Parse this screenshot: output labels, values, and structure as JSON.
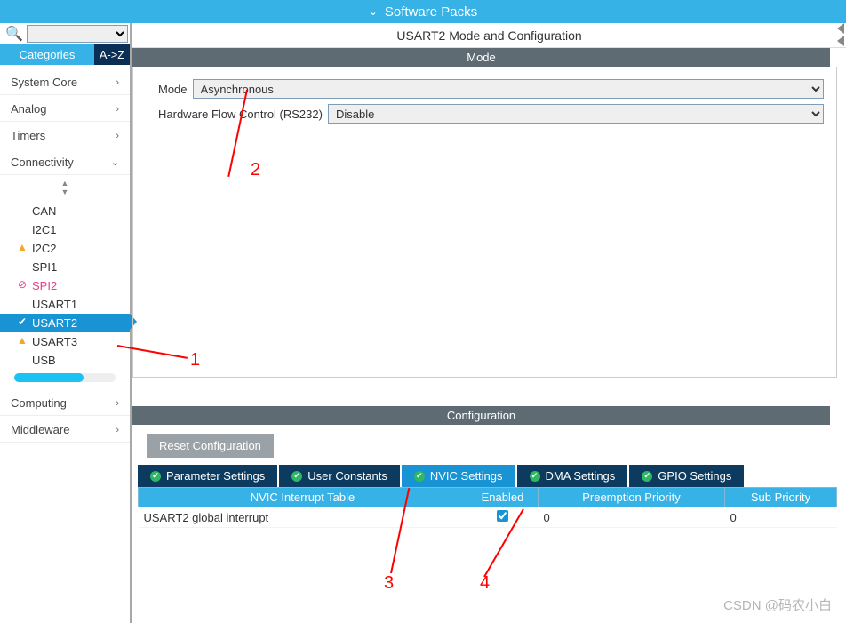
{
  "topbar": {
    "title": "Software Packs"
  },
  "sidebar": {
    "tabs": {
      "categories": "Categories",
      "az": "A->Z"
    },
    "groups": [
      {
        "label": "System Core",
        "chev": "›"
      },
      {
        "label": "Analog",
        "chev": "›"
      },
      {
        "label": "Timers",
        "chev": "›"
      },
      {
        "label": "Connectivity",
        "chev": "⌄",
        "expanded": true,
        "items": [
          {
            "label": "CAN",
            "state": "plain"
          },
          {
            "label": "I2C1",
            "state": "plain"
          },
          {
            "label": "I2C2",
            "state": "warn"
          },
          {
            "label": "SPI1",
            "state": "plain"
          },
          {
            "label": "SPI2",
            "state": "no"
          },
          {
            "label": "USART1",
            "state": "plain"
          },
          {
            "label": "USART2",
            "state": "sel"
          },
          {
            "label": "USART3",
            "state": "warn"
          },
          {
            "label": "USB",
            "state": "plain"
          }
        ]
      },
      {
        "label": "Computing",
        "chev": "›"
      },
      {
        "label": "Middleware",
        "chev": "›"
      }
    ]
  },
  "main": {
    "title": "USART2 Mode and Configuration",
    "mode_header": "Mode",
    "rows": {
      "mode_label": "Mode",
      "mode_value": "Asynchronous",
      "hw_label": "Hardware Flow Control (RS232)",
      "hw_value": "Disable"
    },
    "conf_header": "Configuration",
    "reset": "Reset Configuration",
    "tabs": [
      {
        "label": "Parameter Settings"
      },
      {
        "label": "User Constants"
      },
      {
        "label": "NVIC Settings",
        "active": true
      },
      {
        "label": "DMA Settings"
      },
      {
        "label": "GPIO Settings"
      }
    ],
    "nvic": {
      "headers": {
        "a": "NVIC Interrupt Table",
        "b": "Enabled",
        "c": "Preemption Priority",
        "d": "Sub Priority"
      },
      "row": {
        "name": "USART2 global interrupt",
        "enabled": true,
        "preempt": "0",
        "sub": "0"
      }
    }
  },
  "annotations": {
    "n1": "1",
    "n2": "2",
    "n3": "3",
    "n4": "4"
  },
  "watermark": "CSDN @码农小白"
}
